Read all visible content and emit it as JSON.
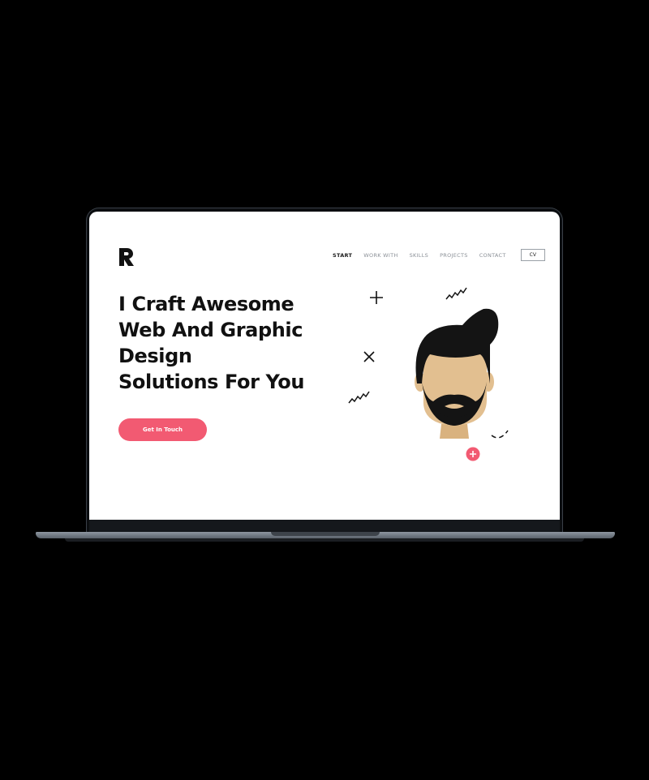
{
  "logo": {
    "icon": "r-logo-icon"
  },
  "nav": {
    "items": [
      {
        "label": "START",
        "active": true
      },
      {
        "label": "WORK WITH",
        "active": false
      },
      {
        "label": "SKILLS",
        "active": false
      },
      {
        "label": "PROJECTS",
        "active": false
      },
      {
        "label": "CONTACT",
        "active": false
      }
    ],
    "cv_label": "CV"
  },
  "hero": {
    "headline_lines": [
      "I Craft Awesome",
      "Web And Graphic",
      "Design",
      "Solutions For You"
    ],
    "cta_label": "Get In Touch"
  },
  "illustration": {
    "subject": "bearded-man-avatar",
    "decorations": [
      "plus-icon",
      "close-icon",
      "squiggle-icon",
      "squiggle-icon",
      "add-circle-icon"
    ]
  },
  "colors": {
    "accent": "#f25a72",
    "text": "#111111",
    "skin": "#e2bf90",
    "hair": "#141414",
    "background": "#ffffff",
    "page_background": "#000000"
  }
}
